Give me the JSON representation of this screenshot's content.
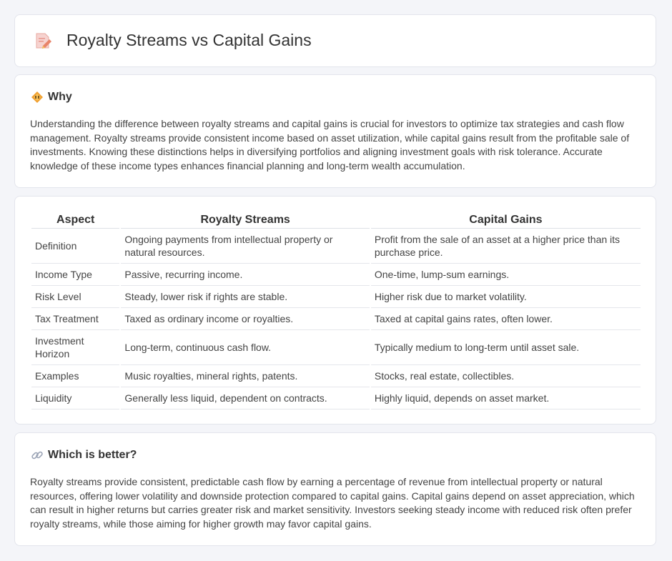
{
  "header": {
    "title": "Royalty Streams vs Capital Gains",
    "icon": "document-pencil-icon"
  },
  "why": {
    "icon": "diamond-warning-icon",
    "title": "Why",
    "body": "Understanding the difference between royalty streams and capital gains is crucial for investors to optimize tax strategies and cash flow management. Royalty streams provide consistent income based on asset utilization, while capital gains result from the profitable sale of investments. Knowing these distinctions helps in diversifying portfolios and aligning investment goals with risk tolerance. Accurate knowledge of these income types enhances financial planning and long-term wealth accumulation."
  },
  "table": {
    "headers": [
      "Aspect",
      "Royalty Streams",
      "Capital Gains"
    ],
    "rows": [
      [
        "Definition",
        "Ongoing payments from intellectual property or natural resources.",
        "Profit from the sale of an asset at a higher price than its purchase price."
      ],
      [
        "Income Type",
        "Passive, recurring income.",
        "One-time, lump-sum earnings."
      ],
      [
        "Risk Level",
        "Steady, lower risk if rights are stable.",
        "Higher risk due to market volatility."
      ],
      [
        "Tax Treatment",
        "Taxed as ordinary income or royalties.",
        "Taxed at capital gains rates, often lower."
      ],
      [
        "Investment Horizon",
        "Long-term, continuous cash flow.",
        "Typically medium to long-term until asset sale."
      ],
      [
        "Examples",
        "Music royalties, mineral rights, patents.",
        "Stocks, real estate, collectibles."
      ],
      [
        "Liquidity",
        "Generally less liquid, dependent on contracts.",
        "Highly liquid, depends on asset market."
      ]
    ]
  },
  "better": {
    "icon": "link-icon",
    "title": "Which is better?",
    "body": "Royalty streams provide consistent, predictable cash flow by earning a percentage of revenue from intellectual property or natural resources, offering lower volatility and downside protection compared to capital gains. Capital gains depend on asset appreciation, which can result in higher returns but carries greater risk and market sensitivity. Investors seeking steady income with reduced risk often prefer royalty streams, while those aiming for higher growth may favor capital gains."
  },
  "colors": {
    "accent": "#e8846a",
    "warning": "#f0a030",
    "border": "#e3e5ec"
  }
}
